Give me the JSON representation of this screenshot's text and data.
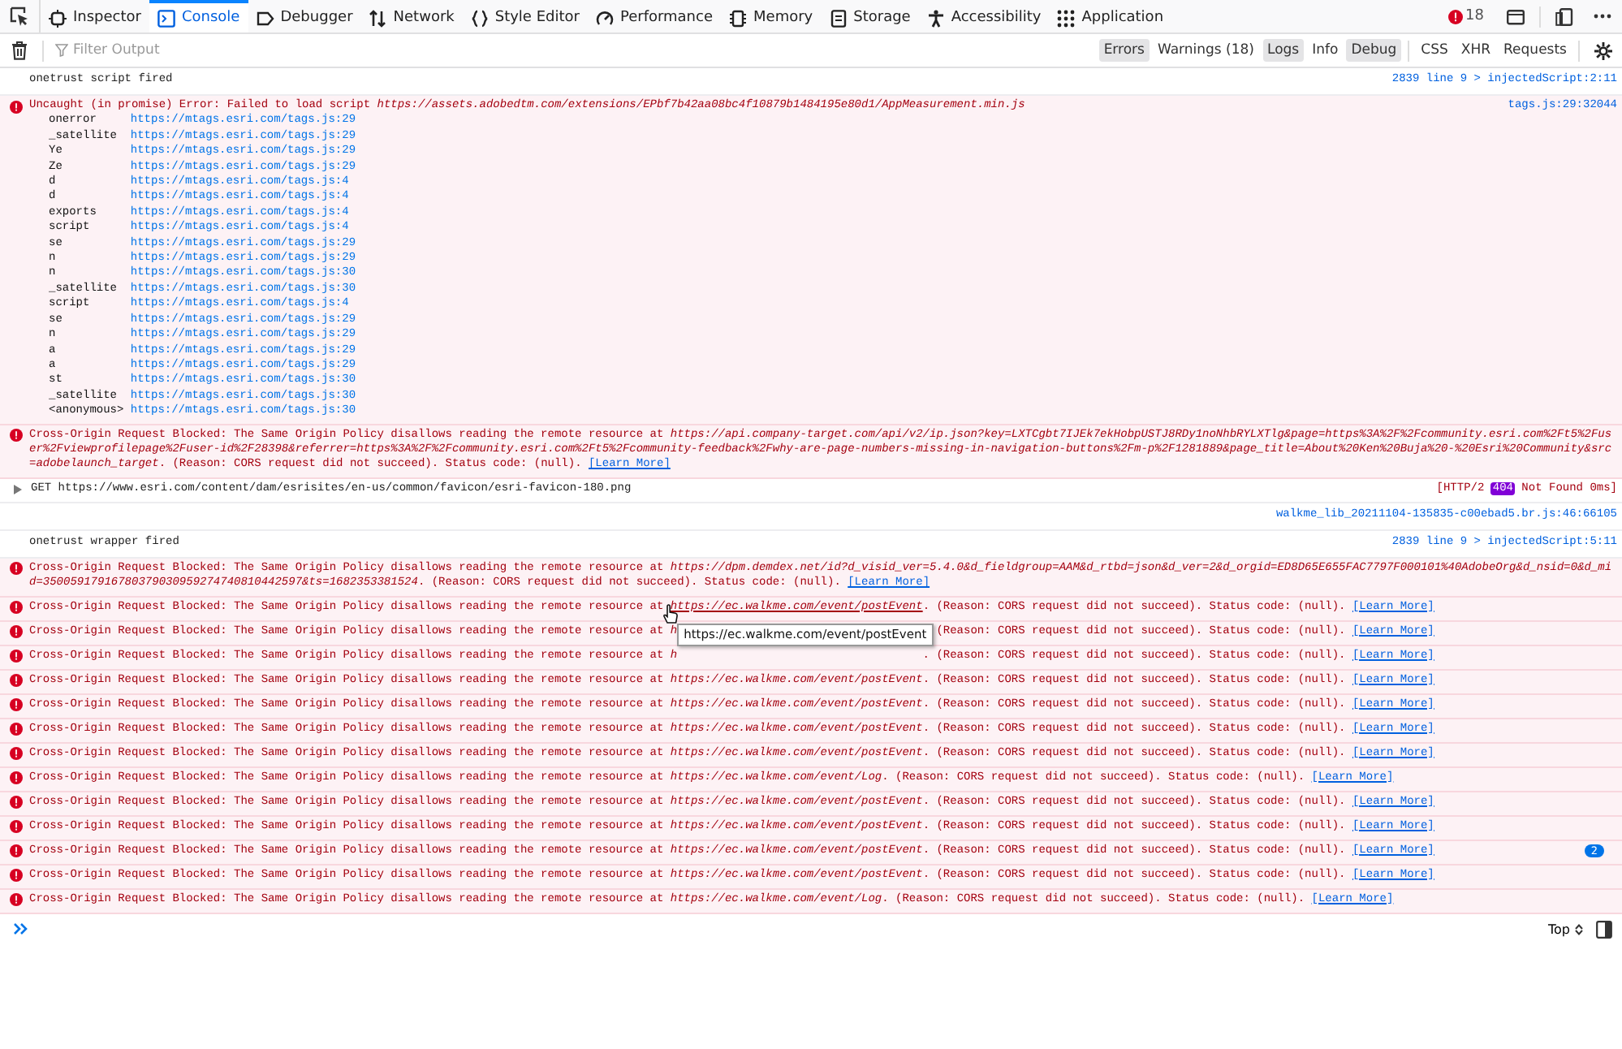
{
  "tabs": [
    {
      "label": "Inspector",
      "selected": false
    },
    {
      "label": "Console",
      "selected": true
    },
    {
      "label": "Debugger",
      "selected": false
    },
    {
      "label": "Network",
      "selected": false
    },
    {
      "label": "Style Editor",
      "selected": false
    },
    {
      "label": "Performance",
      "selected": false
    },
    {
      "label": "Memory",
      "selected": false
    },
    {
      "label": "Storage",
      "selected": false
    },
    {
      "label": "Accessibility",
      "selected": false
    },
    {
      "label": "Application",
      "selected": false
    }
  ],
  "error_count": "18",
  "filter": {
    "placeholder": "Filter Output"
  },
  "filters": [
    {
      "label": "Errors",
      "selected": true
    },
    {
      "label": "Warnings (18)",
      "selected": false
    },
    {
      "label": "Logs",
      "selected": true
    },
    {
      "label": "Info",
      "selected": false
    },
    {
      "label": "Debug",
      "selected": true
    },
    {
      "label": "CSS",
      "selected": false
    },
    {
      "label": "XHR",
      "selected": false
    },
    {
      "label": "Requests",
      "selected": false
    }
  ],
  "messages": [
    {
      "kind": "log",
      "text": "onetrust script fired",
      "location": "2839 line 9 > injectedScript:2:11"
    },
    {
      "kind": "error",
      "text": "Uncaught (in promise) Error: Failed to load script ",
      "url": "https://assets.adobedtm.com/extensions/EPbf7b42aa08bc4f10879b1484195e80d1/AppMeasurement.min.js",
      "location": "tags.js:29:32044",
      "stack": [
        {
          "fn": "onerror",
          "at": "https://mtags.esri.com/tags.js:29"
        },
        {
          "fn": "_satellite",
          "at": "https://mtags.esri.com/tags.js:29"
        },
        {
          "fn": "Ye",
          "at": "https://mtags.esri.com/tags.js:29"
        },
        {
          "fn": "Ze",
          "at": "https://mtags.esri.com/tags.js:29"
        },
        {
          "fn": "d",
          "at": "https://mtags.esri.com/tags.js:4"
        },
        {
          "fn": "d",
          "at": "https://mtags.esri.com/tags.js:4"
        },
        {
          "fn": "exports",
          "at": "https://mtags.esri.com/tags.js:4"
        },
        {
          "fn": "script",
          "at": "https://mtags.esri.com/tags.js:4"
        },
        {
          "fn": "se",
          "at": "https://mtags.esri.com/tags.js:29"
        },
        {
          "fn": "n",
          "at": "https://mtags.esri.com/tags.js:29"
        },
        {
          "fn": "n",
          "at": "https://mtags.esri.com/tags.js:30"
        },
        {
          "fn": "_satellite",
          "at": "https://mtags.esri.com/tags.js:30"
        },
        {
          "fn": "script",
          "at": "https://mtags.esri.com/tags.js:4"
        },
        {
          "fn": "se",
          "at": "https://mtags.esri.com/tags.js:29"
        },
        {
          "fn": "n",
          "at": "https://mtags.esri.com/tags.js:29"
        },
        {
          "fn": "a",
          "at": "https://mtags.esri.com/tags.js:29"
        },
        {
          "fn": "a",
          "at": "https://mtags.esri.com/tags.js:29"
        },
        {
          "fn": "st",
          "at": "https://mtags.esri.com/tags.js:30"
        },
        {
          "fn": "_satellite",
          "at": "https://mtags.esri.com/tags.js:30"
        },
        {
          "fn": "<anonymous>",
          "at": "https://mtags.esri.com/tags.js:30"
        }
      ]
    },
    {
      "kind": "error",
      "text": "Cross-Origin Request Blocked: The Same Origin Policy disallows reading the remote resource at ",
      "url": "https://api.company-target.com/api/v2/ip.json?key=LXTCgbt7IJEk7ekHobpUSTJ8RDy1noNhbRYLXTlg&page=https%3A%2F%2Fcommunity.esri.com%2Ft5%2Fuser%2Fviewprofilepage%2Fuser-id%2F28398&referrer=https%3A%2F%2Fcommunity.esri.com%2Ft5%2Fcommunity-feedback%2Fwhy-are-page-numbers-missing-in-navigation-buttons%2Fm-p%2F1281889&page_title=About%20Ken%20Buja%20-%20Esri%20Community&src=adobelaunch_target",
      "suffix": ". (Reason: CORS request did not succeed). Status code: (null). ",
      "learn": "[Learn More]"
    },
    {
      "kind": "network",
      "method": "GET",
      "url": "https://www.esri.com/content/dam/esrisites/en-us/common/favicon/esri-favicon-180.png",
      "before": "[HTTP/2",
      "status": "404",
      "after": "Not Found 0ms]"
    },
    {
      "kind": "log",
      "location": "walkme_lib_20211104-135835-c00ebad5.br.js:46:66105"
    },
    {
      "kind": "log",
      "text": "onetrust wrapper fired",
      "location": "2839 line 9 > injectedScript:5:11"
    },
    {
      "kind": "error",
      "text": "Cross-Origin Request Blocked: The Same Origin Policy disallows reading the remote resource at ",
      "url": "https://dpm.demdex.net/id?d_visid_ver=5.4.0&d_fieldgroup=AAM&d_rtbd=json&d_ver=2&d_orgid=ED8D65E655FAC7797F000101%40AdobeOrg&d_nsid=0&d_mid=35005917916780379030959274740810442597&ts=1682353381524",
      "suffix": ". (Reason: CORS request did not succeed). Status code: (null). ",
      "learn": "[Learn More]"
    },
    {
      "kind": "error",
      "text": "Cross-Origin Request Blocked: The Same Origin Policy disallows reading the remote resource at ",
      "url": "https://ec.walkme.com/event/postEvent",
      "hovered": true,
      "suffix": ". (Reason: CORS request did not succeed). Status code: (null). ",
      "learn": "[Learn More]"
    },
    {
      "kind": "error",
      "text": "Cross-Origin Request Blocked: The Same Origin Policy disallows reading the remote resource at ",
      "url": "h",
      "covered": true,
      "tooltip": "https://ec.walkme.com/event/postEvent",
      "suffix": ". (Reason: CORS request did not succeed). Status code: (null). ",
      "learn": "[Learn More]"
    },
    {
      "kind": "error",
      "text": "Cross-Origin Request Blocked: The Same Origin Policy disallows reading the remote resource at ",
      "url": "h",
      "covered": true,
      "suffix": ". (Reason: CORS request did not succeed). Status code: (null). ",
      "learn": "[Learn More]"
    },
    {
      "kind": "error",
      "text": "Cross-Origin Request Blocked: The Same Origin Policy disallows reading the remote resource at ",
      "url": "https://ec.walkme.com/event/postEvent",
      "suffix": ". (Reason: CORS request did not succeed). Status code: (null). ",
      "learn": "[Learn More]"
    },
    {
      "kind": "error",
      "text": "Cross-Origin Request Blocked: The Same Origin Policy disallows reading the remote resource at ",
      "url": "https://ec.walkme.com/event/postEvent",
      "suffix": ". (Reason: CORS request did not succeed). Status code: (null). ",
      "learn": "[Learn More]"
    },
    {
      "kind": "error",
      "text": "Cross-Origin Request Blocked: The Same Origin Policy disallows reading the remote resource at ",
      "url": "https://ec.walkme.com/event/postEvent",
      "suffix": ". (Reason: CORS request did not succeed). Status code: (null). ",
      "learn": "[Learn More]"
    },
    {
      "kind": "error",
      "text": "Cross-Origin Request Blocked: The Same Origin Policy disallows reading the remote resource at ",
      "url": "https://ec.walkme.com/event/postEvent",
      "suffix": ". (Reason: CORS request did not succeed). Status code: (null). ",
      "learn": "[Learn More]"
    },
    {
      "kind": "error",
      "text": "Cross-Origin Request Blocked: The Same Origin Policy disallows reading the remote resource at ",
      "url": "https://ec.walkme.com/event/Log",
      "suffix": ". (Reason: CORS request did not succeed). Status code: (null). ",
      "learn": "[Learn More]"
    },
    {
      "kind": "error",
      "text": "Cross-Origin Request Blocked: The Same Origin Policy disallows reading the remote resource at ",
      "url": "https://ec.walkme.com/event/postEvent",
      "suffix": ". (Reason: CORS request did not succeed). Status code: (null). ",
      "learn": "[Learn More]"
    },
    {
      "kind": "error",
      "text": "Cross-Origin Request Blocked: The Same Origin Policy disallows reading the remote resource at ",
      "url": "https://ec.walkme.com/event/postEvent",
      "suffix": ". (Reason: CORS request did not succeed). Status code: (null). ",
      "learn": "[Learn More]"
    },
    {
      "kind": "error",
      "text": "Cross-Origin Request Blocked: The Same Origin Policy disallows reading the remote resource at ",
      "url": "https://ec.walkme.com/event/postEvent",
      "suffix": ". (Reason: CORS request did not succeed). Status code: (null). ",
      "learn": "[Learn More]",
      "repeat": "2"
    },
    {
      "kind": "error",
      "text": "Cross-Origin Request Blocked: The Same Origin Policy disallows reading the remote resource at ",
      "url": "https://ec.walkme.com/event/postEvent",
      "suffix": ". (Reason: CORS request did not succeed). Status code: (null). ",
      "learn": "[Learn More]"
    },
    {
      "kind": "error",
      "text": "Cross-Origin Request Blocked: The Same Origin Policy disallows reading the remote resource at ",
      "url": "https://ec.walkme.com/event/Log",
      "suffix": ". (Reason: CORS request did not succeed). Status code: (null). ",
      "learn": "[Learn More]"
    }
  ],
  "prompt": {
    "context": "Top"
  }
}
